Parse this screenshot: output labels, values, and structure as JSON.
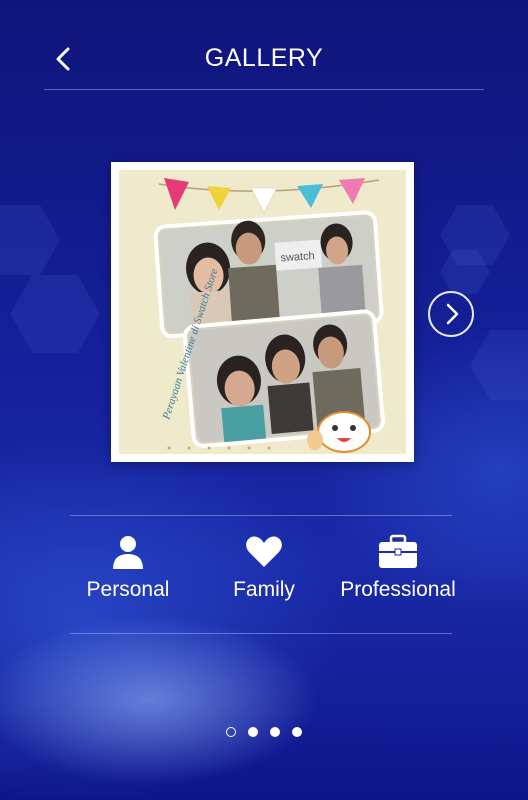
{
  "header": {
    "title": "GALLERY",
    "back_icon": "chevron-left-icon"
  },
  "gallery": {
    "next_icon": "chevron-right-icon",
    "photo_caption": "Perayaan Valentine di Swatch Store"
  },
  "categories": [
    {
      "label": "Personal",
      "icon": "person-icon"
    },
    {
      "label": "Family",
      "icon": "heart-icon"
    },
    {
      "label": "Professional",
      "icon": "briefcase-icon"
    }
  ],
  "pagination": {
    "count": 4,
    "active_index": 0
  },
  "colors": {
    "background_top": "#10157a",
    "background_bottom": "#0f168a",
    "text": "#ffffff",
    "photo_background": "#efeacb"
  }
}
